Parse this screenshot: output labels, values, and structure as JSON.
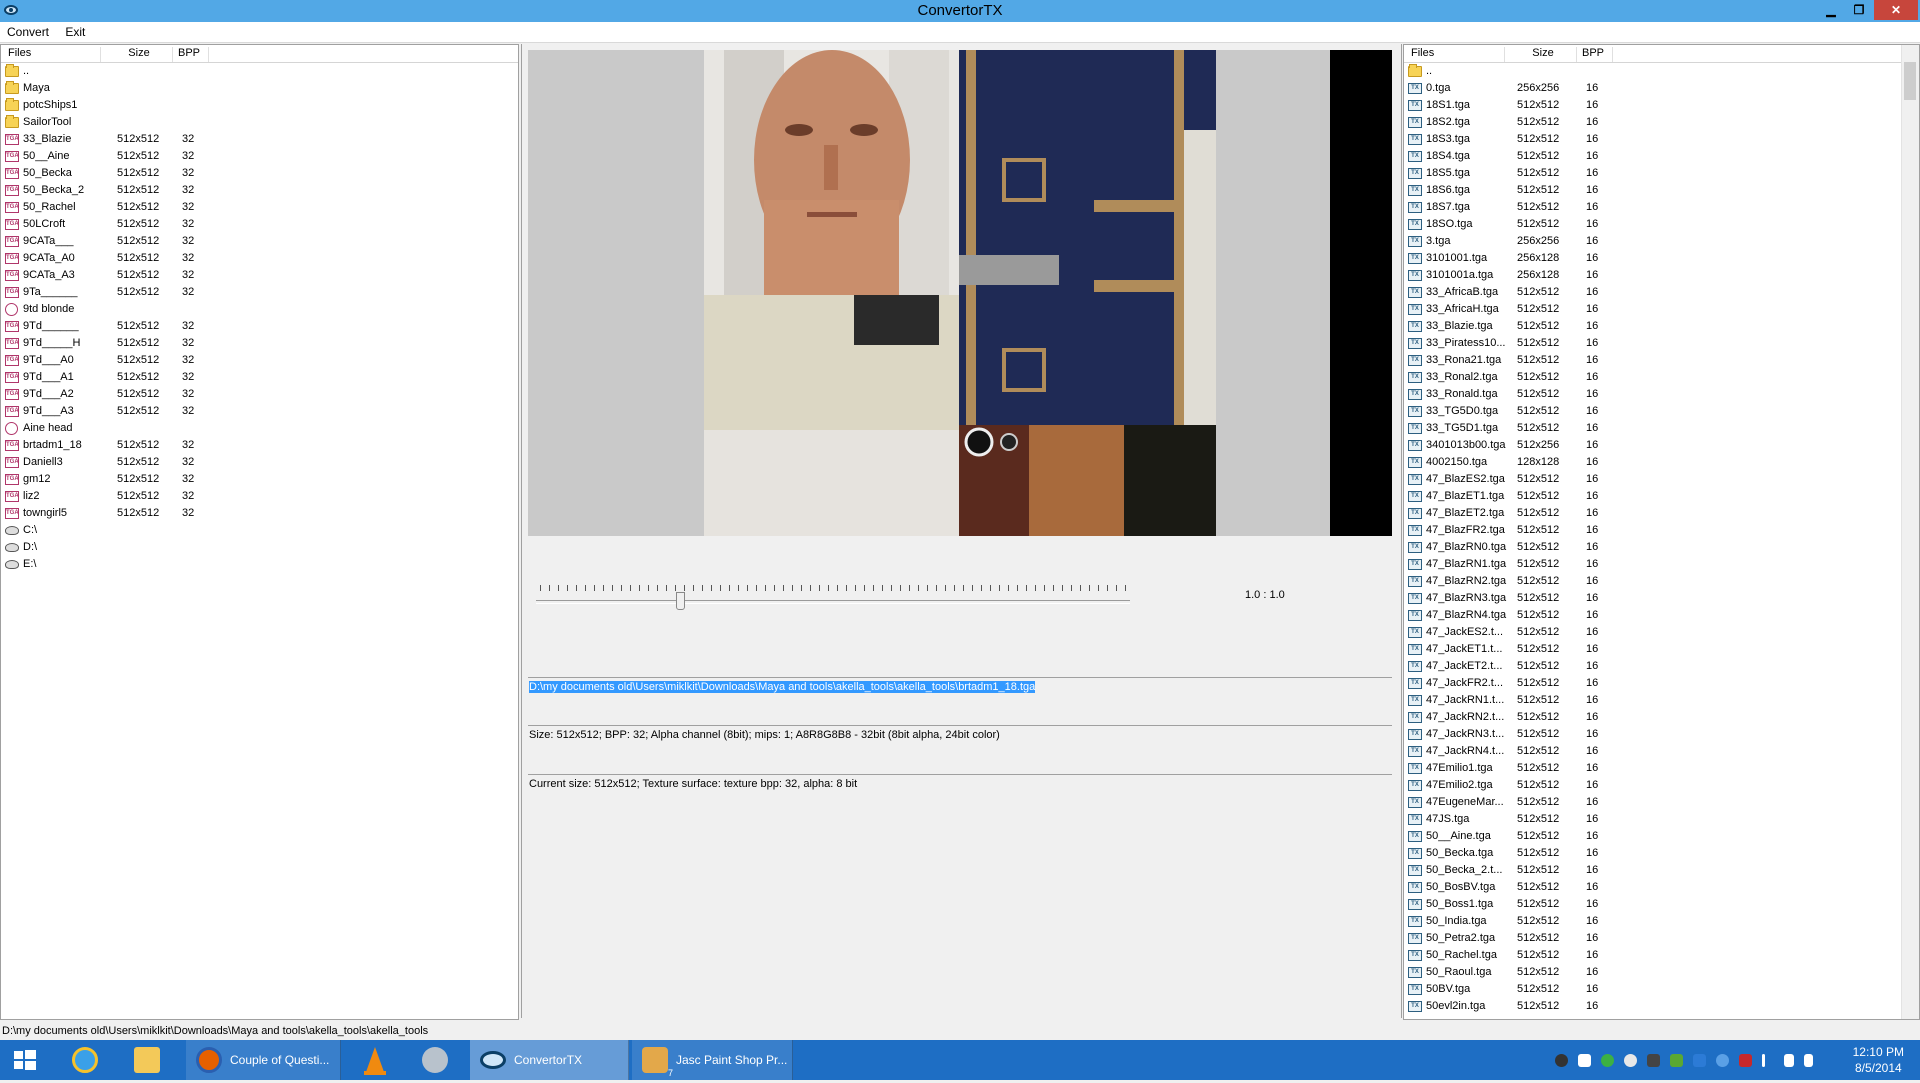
{
  "window": {
    "title": "ConvertorTX",
    "min": "▁",
    "restore": "❐",
    "close": "✕"
  },
  "menu": {
    "items": [
      "Convert",
      "Exit"
    ]
  },
  "left_panel": {
    "headers": {
      "files": "Files",
      "size": "Size",
      "bpp": "BPP"
    },
    "rows": [
      {
        "name": "..",
        "size": "",
        "bpp": "",
        "icon": "folder"
      },
      {
        "name": "Maya",
        "size": "",
        "bpp": "",
        "icon": "folder"
      },
      {
        "name": "potcShips1",
        "size": "",
        "bpp": "",
        "icon": "folder"
      },
      {
        "name": "SailorTool",
        "size": "",
        "bpp": "",
        "icon": "folder"
      },
      {
        "name": "33_Blazie",
        "size": "512x512",
        "bpp": "32",
        "icon": "tga"
      },
      {
        "name": "50__Aine",
        "size": "512x512",
        "bpp": "32",
        "icon": "tga"
      },
      {
        "name": "50_Becka",
        "size": "512x512",
        "bpp": "32",
        "icon": "tga"
      },
      {
        "name": "50_Becka_2",
        "size": "512x512",
        "bpp": "32",
        "icon": "tga"
      },
      {
        "name": "50_Rachel",
        "size": "512x512",
        "bpp": "32",
        "icon": "tga"
      },
      {
        "name": "50LCroft",
        "size": "512x512",
        "bpp": "32",
        "icon": "tga"
      },
      {
        "name": "9CATa___",
        "size": "512x512",
        "bpp": "32",
        "icon": "tga"
      },
      {
        "name": "9CATa_A0",
        "size": "512x512",
        "bpp": "32",
        "icon": "tga"
      },
      {
        "name": "9CATa_A3",
        "size": "512x512",
        "bpp": "32",
        "icon": "tga"
      },
      {
        "name": "9Ta______",
        "size": "512x512",
        "bpp": "32",
        "icon": "tga"
      },
      {
        "name": "9td blonde",
        "size": "",
        "bpp": "",
        "icon": "circle"
      },
      {
        "name": "9Td______",
        "size": "512x512",
        "bpp": "32",
        "icon": "tga"
      },
      {
        "name": "9Td_____H",
        "size": "512x512",
        "bpp": "32",
        "icon": "tga"
      },
      {
        "name": "9Td___A0",
        "size": "512x512",
        "bpp": "32",
        "icon": "tga"
      },
      {
        "name": "9Td___A1",
        "size": "512x512",
        "bpp": "32",
        "icon": "tga"
      },
      {
        "name": "9Td___A2",
        "size": "512x512",
        "bpp": "32",
        "icon": "tga"
      },
      {
        "name": "9Td___A3",
        "size": "512x512",
        "bpp": "32",
        "icon": "tga"
      },
      {
        "name": "Aine head",
        "size": "",
        "bpp": "",
        "icon": "circle"
      },
      {
        "name": "brtadm1_18",
        "size": "512x512",
        "bpp": "32",
        "icon": "tga"
      },
      {
        "name": "Daniell3",
        "size": "512x512",
        "bpp": "32",
        "icon": "tga"
      },
      {
        "name": "gm12",
        "size": "512x512",
        "bpp": "32",
        "icon": "tga"
      },
      {
        "name": "liz2",
        "size": "512x512",
        "bpp": "32",
        "icon": "tga"
      },
      {
        "name": "towngirl5",
        "size": "512x512",
        "bpp": "32",
        "icon": "tga"
      },
      {
        "name": "C:\\",
        "size": "",
        "bpp": "",
        "icon": "drive"
      },
      {
        "name": "D:\\",
        "size": "",
        "bpp": "",
        "icon": "drive"
      },
      {
        "name": "E:\\",
        "size": "",
        "bpp": "",
        "icon": "drive"
      }
    ]
  },
  "center": {
    "zoom": "1.0 : 1.0",
    "path": "D:\\my documents old\\Users\\miklkit\\Downloads\\Maya and tools\\akella_tools\\akella_tools\\brtadm1_18.tga",
    "info": "Size: 512x512; BPP: 32; Alpha channel (8bit); mips: 1; A8R8G8B8 - 32bit (8bit alpha, 24bit color)",
    "current": "Current size: 512x512; Texture surface: texture bpp: 32, alpha: 8 bit"
  },
  "right_panel": {
    "headers": {
      "files": "Files",
      "size": "Size",
      "bpp": "BPP"
    },
    "rows": [
      {
        "name": "..",
        "size": "",
        "bpp": "",
        "icon": "folder"
      },
      {
        "name": "0.tga",
        "size": "256x256",
        "bpp": "16",
        "icon": "tga-b"
      },
      {
        "name": "18S1.tga",
        "size": "512x512",
        "bpp": "16",
        "icon": "tga-b"
      },
      {
        "name": "18S2.tga",
        "size": "512x512",
        "bpp": "16",
        "icon": "tga-b"
      },
      {
        "name": "18S3.tga",
        "size": "512x512",
        "bpp": "16",
        "icon": "tga-b"
      },
      {
        "name": "18S4.tga",
        "size": "512x512",
        "bpp": "16",
        "icon": "tga-b"
      },
      {
        "name": "18S5.tga",
        "size": "512x512",
        "bpp": "16",
        "icon": "tga-b"
      },
      {
        "name": "18S6.tga",
        "size": "512x512",
        "bpp": "16",
        "icon": "tga-b"
      },
      {
        "name": "18S7.tga",
        "size": "512x512",
        "bpp": "16",
        "icon": "tga-b"
      },
      {
        "name": "18SO.tga",
        "size": "512x512",
        "bpp": "16",
        "icon": "tga-b"
      },
      {
        "name": "3.tga",
        "size": "256x256",
        "bpp": "16",
        "icon": "tga-b"
      },
      {
        "name": "3101001.tga",
        "size": "256x128",
        "bpp": "16",
        "icon": "tga-b"
      },
      {
        "name": "3101001a.tga",
        "size": "256x128",
        "bpp": "16",
        "icon": "tga-b"
      },
      {
        "name": "33_AfricaB.tga",
        "size": "512x512",
        "bpp": "16",
        "icon": "tga-b"
      },
      {
        "name": "33_AfricaH.tga",
        "size": "512x512",
        "bpp": "16",
        "icon": "tga-b"
      },
      {
        "name": "33_Blazie.tga",
        "size": "512x512",
        "bpp": "16",
        "icon": "tga-b"
      },
      {
        "name": "33_Piratess10...",
        "size": "512x512",
        "bpp": "16",
        "icon": "tga-b"
      },
      {
        "name": "33_Rona21.tga",
        "size": "512x512",
        "bpp": "16",
        "icon": "tga-b"
      },
      {
        "name": "33_Ronal2.tga",
        "size": "512x512",
        "bpp": "16",
        "icon": "tga-b"
      },
      {
        "name": "33_Ronald.tga",
        "size": "512x512",
        "bpp": "16",
        "icon": "tga-b"
      },
      {
        "name": "33_TG5D0.tga",
        "size": "512x512",
        "bpp": "16",
        "icon": "tga-b"
      },
      {
        "name": "33_TG5D1.tga",
        "size": "512x512",
        "bpp": "16",
        "icon": "tga-b"
      },
      {
        "name": "3401013b00.tga",
        "size": "512x256",
        "bpp": "16",
        "icon": "tga-b"
      },
      {
        "name": "4002150.tga",
        "size": "128x128",
        "bpp": "16",
        "icon": "tga-b"
      },
      {
        "name": "47_BlazES2.tga",
        "size": "512x512",
        "bpp": "16",
        "icon": "tga-b"
      },
      {
        "name": "47_BlazET1.tga",
        "size": "512x512",
        "bpp": "16",
        "icon": "tga-b"
      },
      {
        "name": "47_BlazET2.tga",
        "size": "512x512",
        "bpp": "16",
        "icon": "tga-b"
      },
      {
        "name": "47_BlazFR2.tga",
        "size": "512x512",
        "bpp": "16",
        "icon": "tga-b"
      },
      {
        "name": "47_BlazRN0.tga",
        "size": "512x512",
        "bpp": "16",
        "icon": "tga-b"
      },
      {
        "name": "47_BlazRN1.tga",
        "size": "512x512",
        "bpp": "16",
        "icon": "tga-b"
      },
      {
        "name": "47_BlazRN2.tga",
        "size": "512x512",
        "bpp": "16",
        "icon": "tga-b"
      },
      {
        "name": "47_BlazRN3.tga",
        "size": "512x512",
        "bpp": "16",
        "icon": "tga-b"
      },
      {
        "name": "47_BlazRN4.tga",
        "size": "512x512",
        "bpp": "16",
        "icon": "tga-b"
      },
      {
        "name": "47_JackES2.t...",
        "size": "512x512",
        "bpp": "16",
        "icon": "tga-b"
      },
      {
        "name": "47_JackET1.t...",
        "size": "512x512",
        "bpp": "16",
        "icon": "tga-b"
      },
      {
        "name": "47_JackET2.t...",
        "size": "512x512",
        "bpp": "16",
        "icon": "tga-b"
      },
      {
        "name": "47_JackFR2.t...",
        "size": "512x512",
        "bpp": "16",
        "icon": "tga-b"
      },
      {
        "name": "47_JackRN1.t...",
        "size": "512x512",
        "bpp": "16",
        "icon": "tga-b"
      },
      {
        "name": "47_JackRN2.t...",
        "size": "512x512",
        "bpp": "16",
        "icon": "tga-b"
      },
      {
        "name": "47_JackRN3.t...",
        "size": "512x512",
        "bpp": "16",
        "icon": "tga-b"
      },
      {
        "name": "47_JackRN4.t...",
        "size": "512x512",
        "bpp": "16",
        "icon": "tga-b"
      },
      {
        "name": "47Emilio1.tga",
        "size": "512x512",
        "bpp": "16",
        "icon": "tga-b"
      },
      {
        "name": "47Emilio2.tga",
        "size": "512x512",
        "bpp": "16",
        "icon": "tga-b"
      },
      {
        "name": "47EugeneMar...",
        "size": "512x512",
        "bpp": "16",
        "icon": "tga-b"
      },
      {
        "name": "47JS.tga",
        "size": "512x512",
        "bpp": "16",
        "icon": "tga-b"
      },
      {
        "name": "50__Aine.tga",
        "size": "512x512",
        "bpp": "16",
        "icon": "tga-b"
      },
      {
        "name": "50_Becka.tga",
        "size": "512x512",
        "bpp": "16",
        "icon": "tga-b"
      },
      {
        "name": "50_Becka_2.t...",
        "size": "512x512",
        "bpp": "16",
        "icon": "tga-b"
      },
      {
        "name": "50_BosBV.tga",
        "size": "512x512",
        "bpp": "16",
        "icon": "tga-b"
      },
      {
        "name": "50_Boss1.tga",
        "size": "512x512",
        "bpp": "16",
        "icon": "tga-b"
      },
      {
        "name": "50_India.tga",
        "size": "512x512",
        "bpp": "16",
        "icon": "tga-b"
      },
      {
        "name": "50_Petra2.tga",
        "size": "512x512",
        "bpp": "16",
        "icon": "tga-b"
      },
      {
        "name": "50_Rachel.tga",
        "size": "512x512",
        "bpp": "16",
        "icon": "tga-b"
      },
      {
        "name": "50_Raoul.tga",
        "size": "512x512",
        "bpp": "16",
        "icon": "tga-b"
      },
      {
        "name": "50BV.tga",
        "size": "512x512",
        "bpp": "16",
        "icon": "tga-b"
      },
      {
        "name": "50evl2in.tga",
        "size": "512x512",
        "bpp": "16",
        "icon": "tga-b"
      }
    ]
  },
  "status": {
    "path": "D:\\my documents old\\Users\\miklkit\\Downloads\\Maya and tools\\akella_tools\\akella_tools"
  },
  "taskbar": {
    "items": [
      {
        "label": "Couple of Questi...",
        "icon": "firefox-icon"
      },
      {
        "label": "ConvertorTX",
        "icon": "convertortx-icon"
      },
      {
        "label": "Jasc Paint Shop Pr...",
        "icon": "paintshop-icon",
        "badge": "7"
      }
    ],
    "time": "12:10 PM",
    "date": "8/5/2014"
  },
  "colors": {
    "titlebar": "#52a8e6",
    "taskbar": "#1e6ec4",
    "selection": "#3399ff"
  }
}
